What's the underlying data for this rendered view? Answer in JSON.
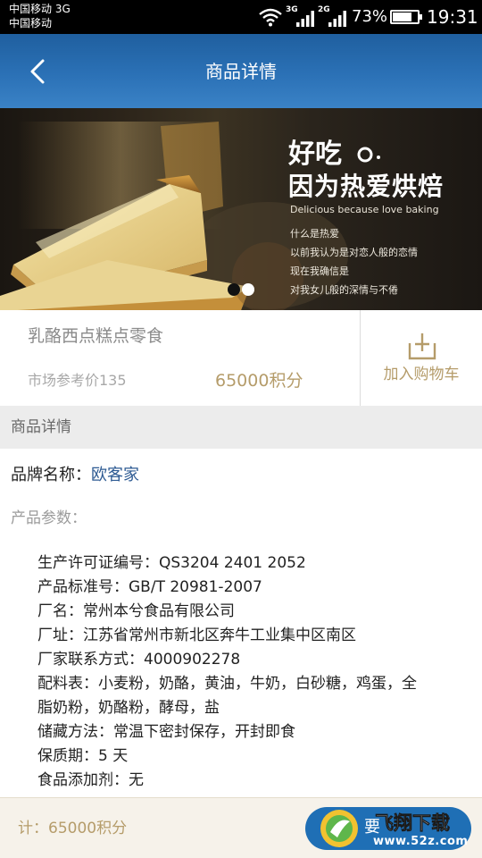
{
  "status_bar": {
    "carrier_1": "中国移动 3G",
    "carrier_2": "中国移动",
    "signal_1_label": "3G",
    "signal_2_label": "2G",
    "battery_percent": "73%",
    "battery_level": 0.73,
    "time": "19:31"
  },
  "header": {
    "title": "商品详情",
    "back_icon": "chevron-left-icon"
  },
  "banner": {
    "headline_1": "好吃",
    "headline_2": "因为热爱烘焙",
    "subtitle": "Delicious because love baking",
    "poem": [
      "什么是热爱",
      "以前我认为是对恋人般的恋情",
      "现在我确信是",
      "对我女儿般的深情与不倦"
    ],
    "slide_count": 2,
    "active_slide": 1
  },
  "product": {
    "name": "乳酪西点糕点零食",
    "market_price": "市场参考价135",
    "points": "65000积分",
    "add_to_cart": "加入购物车",
    "cart_icon": "cart-add-icon"
  },
  "details": {
    "section_title": "商品详情",
    "brand_label": "品牌名称：",
    "brand_value": "欧客家",
    "params_label": "产品参数：",
    "specs": [
      "生产许可证编号：QS3204 2401 2052",
      "产品标准号：GB/T 20981-2007",
      "厂名：常州本兮食品有限公司",
      "厂址：江苏省常州市新北区奔牛工业集中区南区",
      "厂家联系方式：4000902278",
      "配料表：小麦粉，奶酪，黄油，牛奶，白砂糖，鸡蛋，全",
      "脂奶粉，奶酪粉，酵母，盐",
      "储藏方法：常温下密封保存，开封即食",
      "保质期：5 天",
      "食品添加剂：无"
    ]
  },
  "bottom_bar": {
    "total": "计：65000积分",
    "exchange_partial": "要",
    "watermark_text": "飞翔下载",
    "watermark_url": "www.52z.com"
  },
  "colors": {
    "header_blue": "#2b71b6",
    "gold": "#b59c6a",
    "brand_blue": "#2e5b93"
  }
}
